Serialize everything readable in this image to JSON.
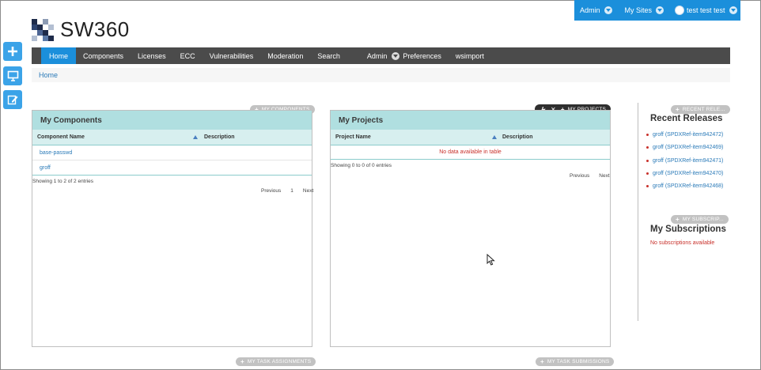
{
  "dock": {
    "admin_label": "Admin",
    "mysites_label": "My Sites",
    "user_label": "test test test"
  },
  "side_buttons": [
    "plus-icon",
    "monitor-icon",
    "edit-icon"
  ],
  "logo": {
    "text": "SW360"
  },
  "nav": {
    "items": [
      "Home",
      "Components",
      "Licenses",
      "ECC",
      "Vulnerabilities",
      "Moderation",
      "Search"
    ],
    "admin_label": "Admin",
    "preferences_label": "Preferences",
    "wsimport_label": "wsimport"
  },
  "breadcrumb": {
    "home": "Home"
  },
  "my_components": {
    "pill": "MY COMPONENTS",
    "title": "My Components",
    "col_name": "Component Name",
    "col_desc": "Description",
    "rows": [
      "base-passwd",
      "groff"
    ],
    "info": "Showing 1 to 2 of 2 entries",
    "prev": "Previous",
    "page": "1",
    "next": "Next"
  },
  "my_projects": {
    "pill": "MY PROJECTS",
    "title": "My Projects",
    "col_name": "Project Name",
    "col_desc": "Description",
    "empty": "No data available in table",
    "info": "Showing 0 to 0 of 0 entries",
    "prev": "Previous",
    "next": "Next"
  },
  "recent_releases": {
    "pill": "RECENT RELE...",
    "title": "Recent Releases",
    "items": [
      "groff (SPDXRef-item942472)",
      "groff (SPDXRef-item942469)",
      "groff (SPDXRef-item942471)",
      "groff (SPDXRef-item942470)",
      "groff (SPDXRef-item942468)"
    ]
  },
  "my_subscriptions": {
    "pill": "MY SUBSCRIP...",
    "title": "My Subscriptions",
    "empty": "No subscriptions available"
  },
  "bottom_pills": {
    "task_assignments": "MY TASK ASSIGNMENTS",
    "task_submissions": "MY TASK SUBMISSIONS"
  },
  "colors": {
    "accent": "#1b8fdb",
    "nav_bg": "#4b4b4b",
    "portlet_head": "#b0dfe0",
    "link": "#2a7ab8",
    "empty_text": "#c8302a"
  }
}
